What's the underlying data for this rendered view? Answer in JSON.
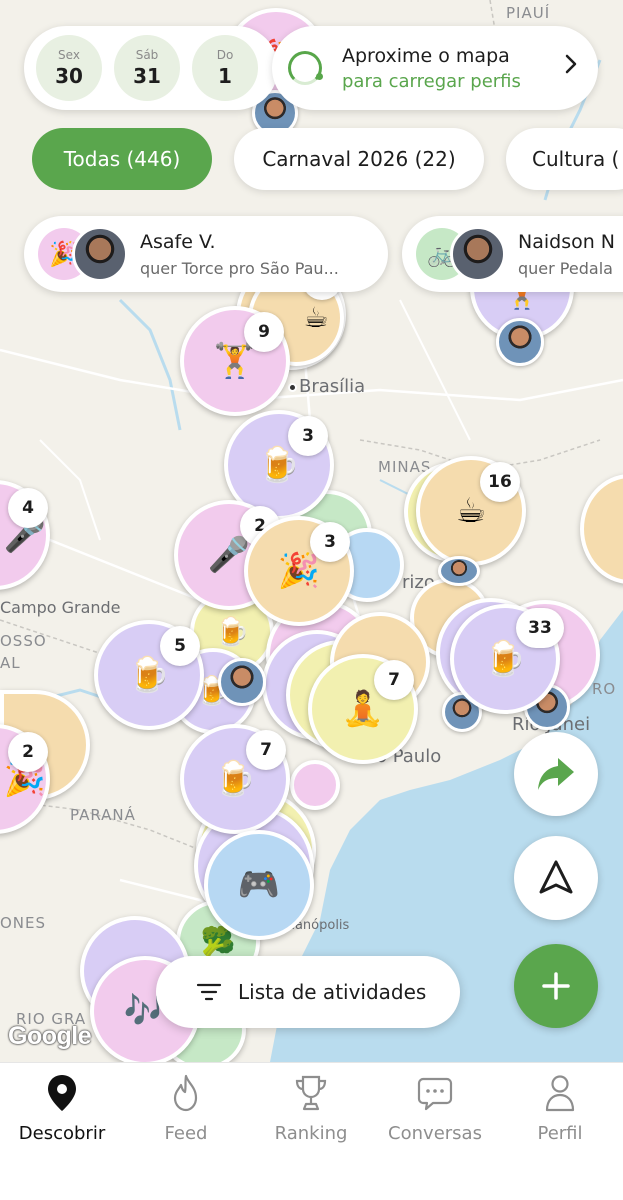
{
  "dates": [
    {
      "dow": "Sex",
      "day": "30"
    },
    {
      "dow": "Sáb",
      "day": "31"
    },
    {
      "dow": "Do",
      "day": "1"
    }
  ],
  "zoom_banner": {
    "title": "Aproxime o mapa",
    "subtitle": "para carregar perfis"
  },
  "filters": [
    {
      "label": "Todas (446)",
      "active": true
    },
    {
      "label": "Carnaval 2026 (22)",
      "active": false
    },
    {
      "label": "Cultura (",
      "active": false
    }
  ],
  "profile_cards": [
    {
      "name": "Asafe V.",
      "desc": "quer Torce pro São Pau...",
      "activity_icon": "🎉"
    },
    {
      "name": "Naidson N",
      "desc": "quer Pedala",
      "activity_icon": "🚲"
    }
  ],
  "map": {
    "region_labels": [
      "PIAUÍ",
      "MINAS",
      "PARANÁ",
      "OSSO",
      "AL",
      "ONES",
      "RIO GRA",
      "RO"
    ],
    "cities": [
      "Brasília",
      "Campo Grande",
      "o Paulo",
      "Rio Janei",
      "rizo",
      "rianópolis"
    ],
    "clusters": [
      {
        "emoji": "🎉",
        "count": ""
      },
      {
        "emoji": "☕",
        "count": "3"
      },
      {
        "emoji": "🏋️",
        "count": "9"
      },
      {
        "emoji": "🍺",
        "count": "3"
      },
      {
        "emoji": "🎤",
        "count": "4"
      },
      {
        "emoji": "☕",
        "count": "16"
      },
      {
        "emoji": "🎤",
        "count": "2"
      },
      {
        "emoji": "🎉",
        "count": "3"
      },
      {
        "emoji": "🍺",
        "count": "5"
      },
      {
        "emoji": "🍺",
        "count": "33"
      },
      {
        "emoji": "🧘",
        "count": "7"
      },
      {
        "emoji": "🎉",
        "count": "2"
      },
      {
        "emoji": "🍺",
        "count": "7"
      },
      {
        "emoji": "🎮",
        "count": ""
      },
      {
        "emoji": "🎶",
        "count": ""
      },
      {
        "emoji": "🏋️",
        "count": ""
      }
    ],
    "attribution": "Google"
  },
  "list_button": {
    "label": "Lista de atividades"
  },
  "tabs": [
    {
      "label": "Descobrir",
      "icon": "location-pin-icon",
      "active": true
    },
    {
      "label": "Feed",
      "icon": "flame-icon",
      "active": false
    },
    {
      "label": "Ranking",
      "icon": "trophy-icon",
      "active": false
    },
    {
      "label": "Conversas",
      "icon": "chat-bubble-icon",
      "active": false
    },
    {
      "label": "Perfil",
      "icon": "person-icon",
      "active": false
    }
  ],
  "colors": {
    "accent_green": "#5aa64d",
    "map_land": "#f3f1ea",
    "map_water": "#b9dcee",
    "cluster_purple": "#d8cdf5",
    "cluster_orange": "#f5dcae",
    "cluster_pink": "#f2cbed",
    "cluster_yellow": "#f2f0b0",
    "cluster_blue": "#b7d8f3",
    "cluster_green": "#c6e8c6"
  }
}
